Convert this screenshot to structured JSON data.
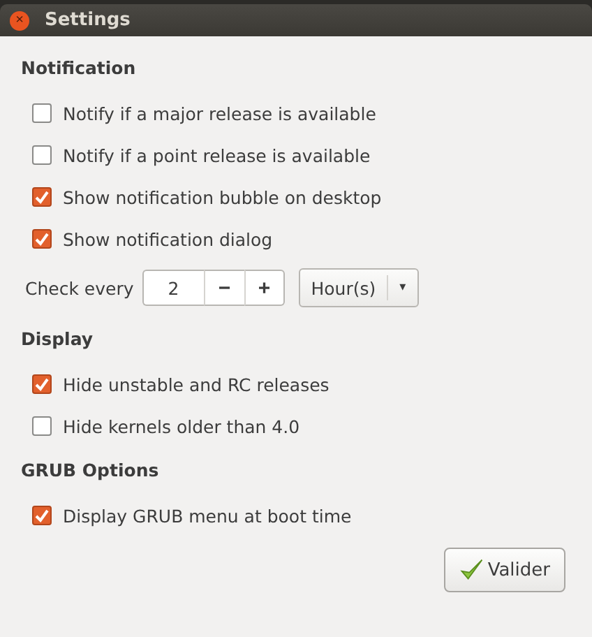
{
  "window": {
    "title": "Settings",
    "close_button": "×"
  },
  "sections": [
    {
      "title": "Notification",
      "items": [
        {
          "kind": "checkbox",
          "label": "Notify if a major release is available",
          "checked": false
        },
        {
          "kind": "checkbox",
          "label": "Notify if a point release is available",
          "checked": false
        },
        {
          "kind": "checkbox",
          "label": "Show notification bubble on desktop",
          "checked": true
        },
        {
          "kind": "checkbox",
          "label": "Show notification dialog",
          "checked": true
        },
        {
          "kind": "interval",
          "label": "Check every",
          "value": "2",
          "decrement": "−",
          "increment": "+",
          "unit": "Hour(s)",
          "arrow": "▾"
        }
      ]
    },
    {
      "title": "Display",
      "items": [
        {
          "kind": "checkbox",
          "label": "Hide unstable and RC releases",
          "checked": true
        },
        {
          "kind": "checkbox",
          "label": "Hide kernels older than 4.0",
          "checked": false
        }
      ]
    },
    {
      "title": "GRUB Options",
      "items": [
        {
          "kind": "checkbox",
          "label": "Display GRUB menu at boot time",
          "checked": true
        }
      ]
    }
  ],
  "buttons": [
    {
      "label": "Valider"
    }
  ]
}
